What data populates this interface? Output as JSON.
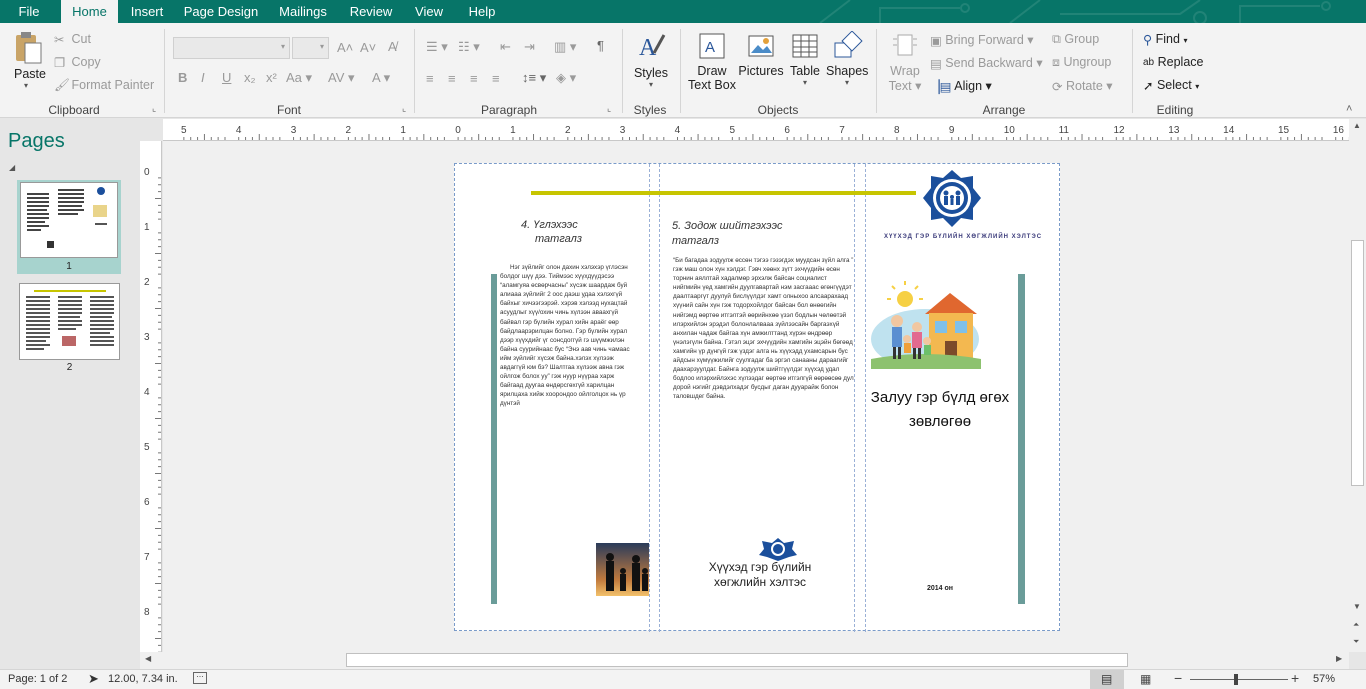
{
  "tabs": [
    "File",
    "Home",
    "Insert",
    "Page Design",
    "Mailings",
    "Review",
    "View",
    "Help"
  ],
  "active_tab": "Home",
  "clipboard": {
    "paste": "Paste",
    "cut": "Cut",
    "copy": "Copy",
    "format_painter": "Format Painter",
    "label": "Clipboard"
  },
  "font": {
    "label": "Font"
  },
  "paragraph": {
    "label": "Paragraph"
  },
  "styles": {
    "button": "Styles",
    "label": "Styles"
  },
  "objects": {
    "draw_line1": "Draw",
    "draw_line2": "Text Box",
    "pictures": "Pictures",
    "table": "Table",
    "shapes": "Shapes",
    "label": "Objects"
  },
  "arrange": {
    "wrap_line1": "Wrap",
    "wrap_line2": "Text",
    "bring_forward": "Bring Forward",
    "send_backward": "Send Backward",
    "align": "Align",
    "group": "Group",
    "ungroup": "Ungroup",
    "rotate": "Rotate",
    "label": "Arrange"
  },
  "editing": {
    "find": "Find",
    "replace": "Replace",
    "select": "Select",
    "label": "Editing"
  },
  "pages_pane": {
    "title": "Pages",
    "page1": "1",
    "page2": "2"
  },
  "hruler_labels": [
    "5",
    "4",
    "3",
    "2",
    "1",
    "0",
    "1",
    "2",
    "3",
    "4",
    "5",
    "6",
    "7",
    "8",
    "9",
    "10",
    "11",
    "12",
    "13",
    "14",
    "15",
    "16"
  ],
  "vruler_labels": [
    "0",
    "1",
    "2",
    "3",
    "4",
    "5",
    "6",
    "7",
    "8"
  ],
  "doc": {
    "panel1_title_line1": "4. Үглэхээс",
    "panel1_title_line2": "татгалз",
    "panel1_body": "Нэг зүйлийг олон дахин хэлэхэр үглэсэн болдог шүү дээ. Тиймээс хүүхдүүдэсээ “аламгуяа өсвөрчасны” хүсэж шаардаж буй алиааа зүйлийг 2 оос даэш удаа хэлэхгүй байхыг хичээгээрэй. хэрэв хэлээд нухацтай асуудлыг хүү/охин чинь хүлээн аваахгүй байвал гэр бүлийн хурал хийн араёг өөр байдлаарэрилцан болно. Гэр бүлийн хурал дээр хүүхдийг үг сонсдоггүй гэ шүүмжилэн байна суурийнаас бус “Энэ аав чинь чамаас ийм зүйлийг хүсэж байна.хэлэх хүлээж авдаггүй юм бэ? Шалтгаа хүлээж авна гэж ойлгож болох уу” гэж нуур нүүраа харж байгаад дуугаа өндөрсгөхгүй харилцан ярилцаха хийж хоорондоо ойлголцох нь үр дүнтэй",
    "panel2_title_line1": "5. Зодож шийтгэхээс",
    "panel2_title_line2": "татгалз",
    "panel2_body": "“Би багадаа зодуулж өссөн тэгээ гэзэгдэх муудсан зүйл алга ” гэж маш олон хүн хэлдэг. Гэвч хөөнх зүгт эхчүүдийн өсөн торнин аяллтай хадалмөр эрхэлж байсан социалист нийгмийн үед хамгийн дуулгавартай нэм засгааас өгөнгүүдэт даалтааргүт дуулуй бислүүлдэг хамт олныхоо алсаарахаад хүүний сайн хүн гэж тодорхойлдог байсан бол өнөөгийн нийгэмд өөртөө итгэлтэй өөрийнхөө үзэл бодлын чөлөөтэй илэрхийлэн эрэдэл болонлалвааа зүйлээсайн баргаэхүй анхилан чадаж байгаа хүн амжилттанд хүрэн өндрөөр үнэлэгүлн байна. Гэтэл эцэг эхчүүдийн хамгийн эцэйн бөгөөд хамгийн үр дүнгүй гэж үздэг алга нь хүүхэдд ухамсарын бус айдсын хүмүүжилийг суулгадаг ба эргэл санааны дараагийг даахарзуулдаг. Байнга зодуулж шийтгүүлдэг хүүхэд удал бодлоо илэрхийлэхэс хүлээдаг өөртөө итгэлгүй өөрөөсөө дул дорой нэгийг дэвдэлхадэг бусдыг даган дууарайж болон таловшдег байна.",
    "panel2_footer_line1": "Хүүхэд гэр бүлийн",
    "panel2_footer_line2": "хөгжлийн хэлтэс",
    "panel3_org": "ХҮҮХЭД ГЭР БҮЛИЙН ХӨГЖЛИЙН ХЭЛТЭС",
    "panel3_title_line1": "Залуу гэр бүлд өгөх",
    "panel3_title_line2": "зөвлөгөө",
    "panel3_year": "2014 он"
  },
  "status": {
    "page": "Page: 1 of 2",
    "position": "12.00, 7.34 in.",
    "zoom": "57%"
  },
  "colors": {
    "accent": "#077568",
    "teal_bar": "#6a9c99",
    "yellow_line": "#c7c500",
    "logo_blue": "#1b4f9c"
  }
}
